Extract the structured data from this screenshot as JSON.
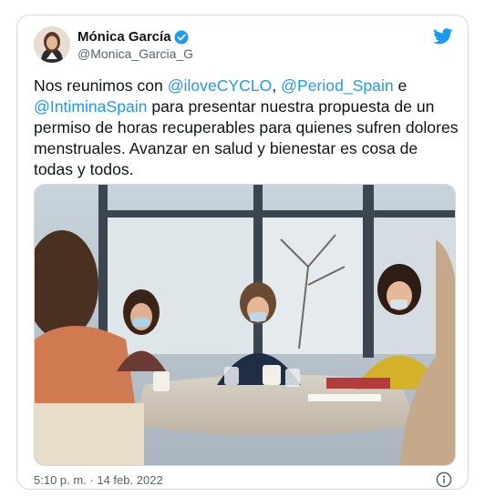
{
  "tweet": {
    "display_name": "Mónica García",
    "handle": "@Monica_Garcia_G",
    "verified_icon": "verified-badge-icon",
    "brand_icon": "twitter-bird-icon",
    "text": {
      "t1": "Nos reunimos con ",
      "m1": "@iloveCYCLO",
      "t2": ", ",
      "m2": "@Period_Spain",
      "t3": " e ",
      "m3": "@IntiminaSpain",
      "t4": " para presentar nuestra propuesta de un permiso de horas recuperables para quienes sufren dolores menstruales. Avanzar en salud y bienestar es cosa de todas y todos."
    },
    "timestamp": "5:10 p. m. · 14 feb. 2022",
    "info_icon": "info-icon"
  },
  "colors": {
    "link": "#1d9bf0",
    "secondary_text": "#536471",
    "border": "#cfd9de"
  }
}
